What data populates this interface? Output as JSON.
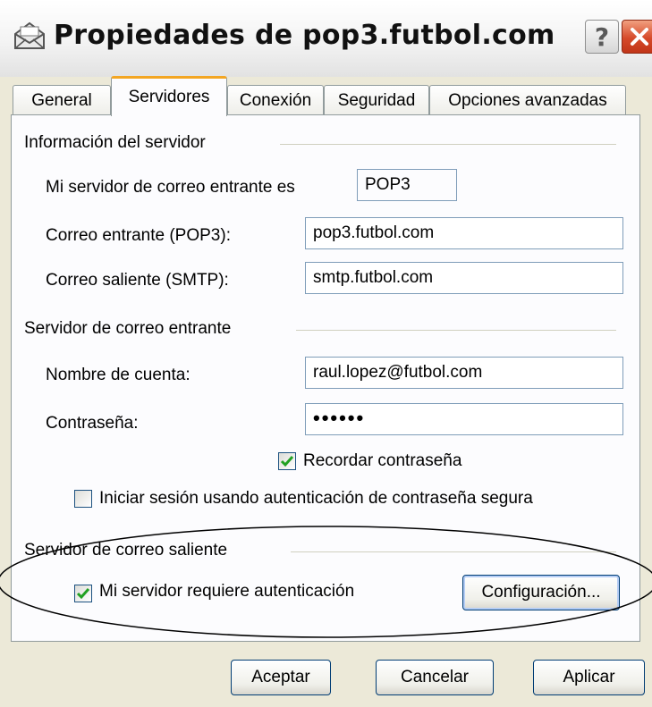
{
  "window": {
    "title": "Propiedades de pop3.futbol.com",
    "help_label": "?",
    "title_icon": "mail-envelope-icon"
  },
  "tabs": [
    {
      "label": "General",
      "active": false
    },
    {
      "label": "Servidores",
      "active": true
    },
    {
      "label": "Conexión",
      "active": false
    },
    {
      "label": "Seguridad",
      "active": false
    },
    {
      "label": "Opciones avanzadas",
      "active": false
    }
  ],
  "server_info": {
    "group_title": "Información del servidor",
    "incoming_type_label": "Mi servidor de correo entrante es",
    "incoming_type_value": "POP3",
    "incoming_label": "Correo entrante (POP3):",
    "incoming_value": "pop3.futbol.com",
    "outgoing_label": "Correo saliente (SMTP):",
    "outgoing_value": "smtp.futbol.com"
  },
  "incoming_server": {
    "group_title": "Servidor de correo entrante",
    "account_label": "Nombre de cuenta:",
    "account_value": "raul.lopez@futbol.com",
    "password_label": "Contraseña:",
    "password_value": "••••••",
    "remember_label": "Recordar contraseña",
    "remember_checked": true,
    "spa_label": "Iniciar sesión usando autenticación de contraseña segura",
    "spa_checked": false
  },
  "outgoing_server": {
    "group_title": "Servidor de correo saliente",
    "auth_label": "Mi servidor requiere autenticación",
    "auth_checked": true,
    "settings_button": "Configuración..."
  },
  "footer": {
    "ok": "Aceptar",
    "cancel": "Cancelar",
    "apply": "Aplicar"
  },
  "colors": {
    "dialog_bg": "#ece9d8",
    "tab_accent": "#f3a623",
    "check_green": "#21a121",
    "close_red": "#d64a2a"
  }
}
